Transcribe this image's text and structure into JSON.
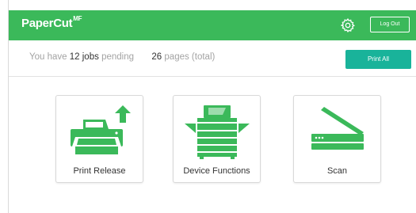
{
  "header": {
    "logo_text": "PaperCut",
    "logo_suffix": "MF",
    "settings_icon": "gear-icon",
    "logout_label": "Log Out",
    "background_color": "#3bb95a"
  },
  "status": {
    "prefix": "You have",
    "jobs_count": "12",
    "jobs_word": "jobs",
    "pending_word": "pending",
    "pages_count": "26",
    "pages_suffix": "pages (total)"
  },
  "actions": {
    "print_all_label": "Print All",
    "print_all_color": "#19b39a"
  },
  "tiles": [
    {
      "label": "Print Release",
      "icon": "printer-upload-icon"
    },
    {
      "label": "Device Functions",
      "icon": "copier-icon"
    },
    {
      "label": "Scan",
      "icon": "scanner-icon"
    }
  ],
  "accent_color": "#3bb95a"
}
